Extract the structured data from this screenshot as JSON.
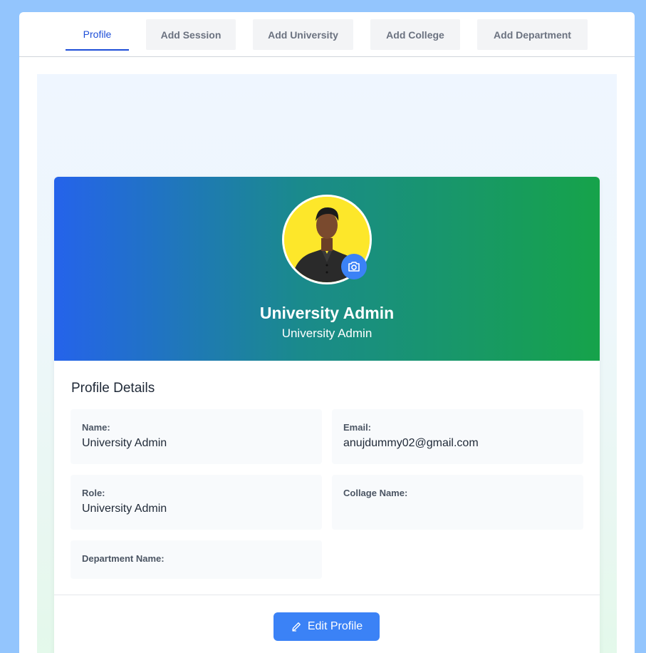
{
  "tabs": [
    {
      "label": "Profile",
      "active": true
    },
    {
      "label": "Add Session"
    },
    {
      "label": "Add University"
    },
    {
      "label": "Add College"
    },
    {
      "label": "Add Department"
    }
  ],
  "profile": {
    "name": "University Admin",
    "role": "University Admin",
    "camera_icon": "camera-icon"
  },
  "details": {
    "title": "Profile Details",
    "fields": [
      {
        "label": "Name:",
        "value": "University Admin"
      },
      {
        "label": "Email:",
        "value": "anujdummy02@gmail.com"
      },
      {
        "label": "Role:",
        "value": "University Admin"
      },
      {
        "label": "Collage Name:",
        "value": ""
      },
      {
        "label": "Department Name:",
        "value": ""
      }
    ]
  },
  "actions": {
    "edit_label": "Edit Profile",
    "edit_icon": "pencil-icon"
  },
  "colors": {
    "accent": "#3b82f6",
    "tab_active": "#1d4ed8",
    "hero_start": "#2563eb",
    "hero_end": "#16a34a",
    "avatar_bg": "#fde72a"
  }
}
